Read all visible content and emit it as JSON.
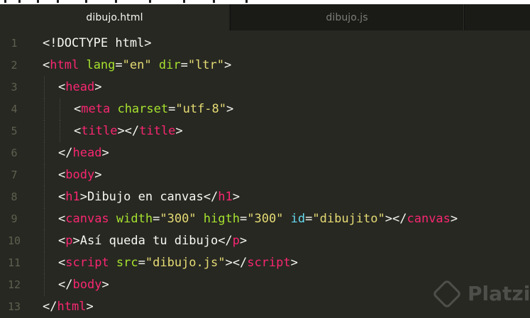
{
  "tabs": [
    {
      "label": "dibujo.html",
      "active": true
    },
    {
      "label": "dibujo.js",
      "active": false
    }
  ],
  "editor": {
    "lines": [
      {
        "n": "1",
        "indent": 0,
        "tokens": [
          [
            "pun",
            "<!DOCTYPE html>"
          ]
        ]
      },
      {
        "n": "2",
        "indent": 0,
        "tokens": [
          [
            "pun",
            "<"
          ],
          [
            "tag",
            "html"
          ],
          [
            "pun",
            " "
          ],
          [
            "attr",
            "lang"
          ],
          [
            "pun",
            "="
          ],
          [
            "str",
            "\"en\""
          ],
          [
            "pun",
            " "
          ],
          [
            "attr",
            "dir"
          ],
          [
            "pun",
            "="
          ],
          [
            "str",
            "\"ltr\""
          ],
          [
            "pun",
            ">"
          ]
        ]
      },
      {
        "n": "3",
        "indent": 1,
        "tokens": [
          [
            "pun",
            "<"
          ],
          [
            "tag",
            "head"
          ],
          [
            "pun",
            ">"
          ]
        ]
      },
      {
        "n": "4",
        "indent": 2,
        "tokens": [
          [
            "pun",
            "<"
          ],
          [
            "tag",
            "meta"
          ],
          [
            "pun",
            " "
          ],
          [
            "attr",
            "charset"
          ],
          [
            "pun",
            "="
          ],
          [
            "str",
            "\"utf-8\""
          ],
          [
            "pun",
            ">"
          ]
        ]
      },
      {
        "n": "5",
        "indent": 2,
        "tokens": [
          [
            "pun",
            "<"
          ],
          [
            "tag",
            "title"
          ],
          [
            "pun",
            "></"
          ],
          [
            "tag",
            "title"
          ],
          [
            "pun",
            ">"
          ]
        ]
      },
      {
        "n": "6",
        "indent": 1,
        "tokens": [
          [
            "pun",
            "</"
          ],
          [
            "tag",
            "head"
          ],
          [
            "pun",
            ">"
          ]
        ]
      },
      {
        "n": "7",
        "indent": 1,
        "tokens": [
          [
            "pun",
            "<"
          ],
          [
            "tag",
            "body"
          ],
          [
            "pun",
            ">"
          ]
        ]
      },
      {
        "n": "8",
        "indent": 1,
        "tokens": [
          [
            "pun",
            "<"
          ],
          [
            "tag",
            "h1"
          ],
          [
            "pun",
            ">Dibujo en canvas</"
          ],
          [
            "tag",
            "h1"
          ],
          [
            "pun",
            ">"
          ]
        ]
      },
      {
        "n": "9",
        "indent": 1,
        "tokens": [
          [
            "pun",
            "<"
          ],
          [
            "tag",
            "canvas"
          ],
          [
            "pun",
            " "
          ],
          [
            "attr",
            "width"
          ],
          [
            "pun",
            "="
          ],
          [
            "str",
            "\"300\""
          ],
          [
            "pun",
            " "
          ],
          [
            "attr",
            "higth"
          ],
          [
            "pun",
            "="
          ],
          [
            "str",
            "\"300\""
          ],
          [
            "pun",
            " "
          ],
          [
            "id",
            "id"
          ],
          [
            "pun",
            "="
          ],
          [
            "str",
            "\"dibujito\""
          ],
          [
            "pun",
            "></"
          ],
          [
            "tag",
            "canvas"
          ],
          [
            "pun",
            ">"
          ]
        ]
      },
      {
        "n": "10",
        "indent": 1,
        "tokens": [
          [
            "pun",
            "<"
          ],
          [
            "tag",
            "p"
          ],
          [
            "pun",
            ">Así queda tu dibujo</"
          ],
          [
            "tag",
            "p"
          ],
          [
            "pun",
            ">"
          ]
        ]
      },
      {
        "n": "11",
        "indent": 1,
        "tokens": [
          [
            "pun",
            "<"
          ],
          [
            "tag",
            "script"
          ],
          [
            "pun",
            " "
          ],
          [
            "attr",
            "src"
          ],
          [
            "pun",
            "="
          ],
          [
            "str",
            "\"dibujo.js\""
          ],
          [
            "pun",
            "></"
          ],
          [
            "tag",
            "script"
          ],
          [
            "pun",
            ">"
          ]
        ]
      },
      {
        "n": "12",
        "indent": 1,
        "tokens": [
          [
            "pun",
            "</"
          ],
          [
            "tag",
            "body"
          ],
          [
            "pun",
            ">"
          ]
        ]
      },
      {
        "n": "13",
        "indent": 0,
        "tokens": [
          [
            "pun",
            "</"
          ],
          [
            "tag",
            "html"
          ],
          [
            "pun",
            ">"
          ]
        ]
      }
    ]
  },
  "watermark": {
    "text": "Platzi"
  },
  "colors": {
    "background": "#272822",
    "tag": "#f92672",
    "attribute": "#a6e22e",
    "string": "#e6db74",
    "id_attribute": "#66d9ef",
    "text": "#f8f8f2"
  }
}
